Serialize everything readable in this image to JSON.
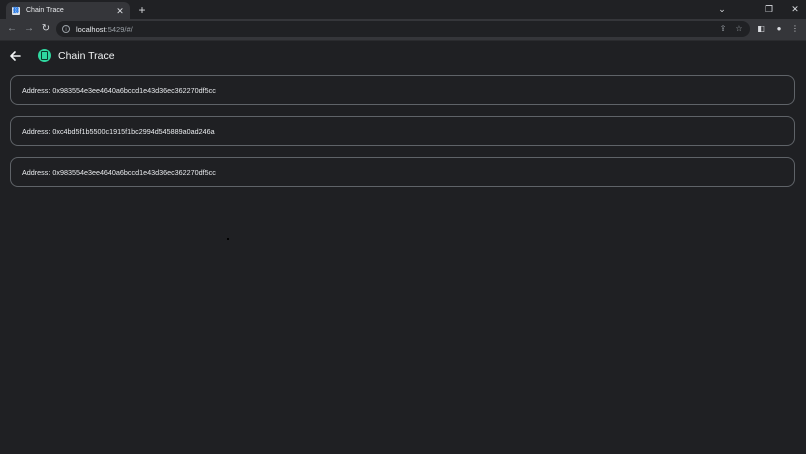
{
  "browser": {
    "tab_title": "Chain Trace",
    "new_tab_glyph": "+",
    "url_host": "localhost",
    "url_rest": ":5429/#/",
    "icons": {
      "back": "arrow-left-icon",
      "forward": "arrow-right-icon",
      "reload": "reload-icon",
      "site_info": "info-icon",
      "share": "share-icon",
      "bookmark": "star-icon",
      "sidebar": "side-panel-icon",
      "profile": "profile-icon",
      "menu": "kebab-menu-icon"
    }
  },
  "app": {
    "title": "Chain Trace",
    "accent_color": "#2fd8a0",
    "addresses": [
      {
        "label": "Address:",
        "value": "0x983554e3ee4640a6bccd1e43d36ec362270df5cc"
      },
      {
        "label": "Address:",
        "value": "0xc4bd5f1b5500c1915f1bc2994d545889a0ad246a"
      },
      {
        "label": "Address:",
        "value": "0x983554e3ee4640a6bccd1e43d36ec362270df5cc"
      }
    ]
  }
}
